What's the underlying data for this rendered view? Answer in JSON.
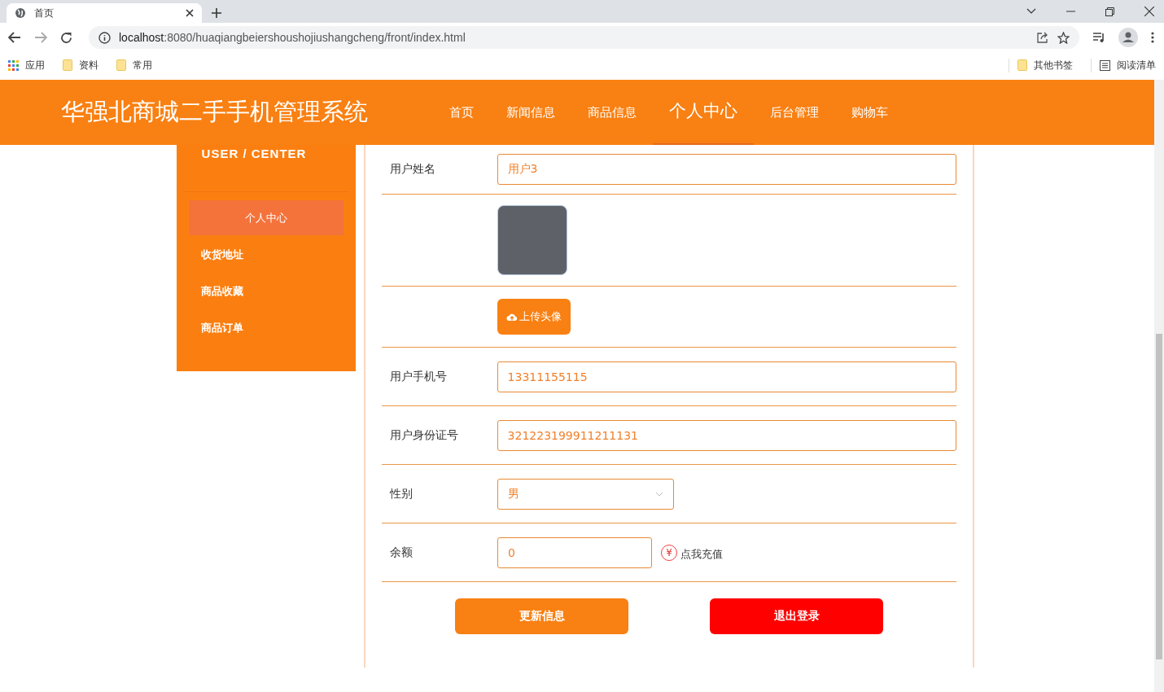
{
  "browser": {
    "tab_title": "首页",
    "url_host": "localhost",
    "url_rest": ":8080/huaqiangbeiershoushojiushangcheng/front/index.html",
    "bookmarks": [
      "应用",
      "资料",
      "常用"
    ],
    "bookmarks_right": [
      "其他书签",
      "阅读清单"
    ]
  },
  "header": {
    "title": "华强北商城二手手机管理系统",
    "nav": [
      {
        "label": "首页",
        "selected": false
      },
      {
        "label": "新闻信息",
        "selected": false
      },
      {
        "label": "商品信息",
        "selected": false
      },
      {
        "label": "个人中心",
        "selected": true
      },
      {
        "label": "后台管理",
        "selected": false
      },
      {
        "label": "购物车",
        "selected": false
      }
    ]
  },
  "sidebar": {
    "heading": "USER / CENTER",
    "items": [
      {
        "label": "个人中心",
        "selected": true
      },
      {
        "label": "收货地址",
        "selected": false
      },
      {
        "label": "商品收藏",
        "selected": false
      },
      {
        "label": "商品订单",
        "selected": false
      }
    ]
  },
  "form": {
    "rows": [
      {
        "kind": "text",
        "label": "用户姓名",
        "value": "用户3"
      },
      {
        "kind": "avatar"
      },
      {
        "kind": "upload",
        "button": "上传头像"
      },
      {
        "kind": "text",
        "label": "用户手机号",
        "value": "13311155115"
      },
      {
        "kind": "text",
        "label": "用户身份证号",
        "value": "321223199911211131"
      },
      {
        "kind": "select",
        "label": "性别",
        "value": "男"
      },
      {
        "kind": "balance",
        "label": "余额",
        "value": "0",
        "recharge_icon": "¥",
        "recharge_link": "点我充值"
      }
    ],
    "buttons": [
      {
        "label": "更新信息",
        "kind": "primary"
      },
      {
        "label": "退出登录",
        "kind": "danger"
      }
    ]
  }
}
